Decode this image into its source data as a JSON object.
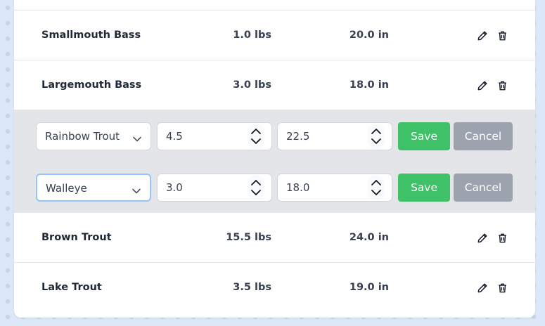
{
  "rows_top": [
    {
      "name": "Smallmouth Bass",
      "weight": "1.0 lbs",
      "length": "20.0 in"
    },
    {
      "name": "Largemouth Bass",
      "weight": "3.0 lbs",
      "length": "18.0 in"
    }
  ],
  "edit_rows": [
    {
      "species": "Rainbow Trout",
      "weight": "4.5",
      "length": "22.5",
      "save": "Save",
      "cancel": "Cancel"
    },
    {
      "species": "Walleye",
      "weight": "3.0",
      "length": "18.0",
      "save": "Save",
      "cancel": "Cancel"
    }
  ],
  "rows_bottom": [
    {
      "name": "Brown Trout",
      "weight": "15.5 lbs",
      "length": "24.0 in"
    },
    {
      "name": "Lake Trout",
      "weight": "3.5 lbs",
      "length": "19.0 in"
    }
  ],
  "icons": {
    "edit": "pencil-icon",
    "delete": "trash-icon",
    "dropdown": "chevron-down-icon",
    "spinner": "stepper-arrows-icon"
  },
  "colors": {
    "save": "#3ec167",
    "cancel": "#9ca3ae",
    "edit_bg": "#e4e5e9",
    "focus": "#93c5fd"
  }
}
